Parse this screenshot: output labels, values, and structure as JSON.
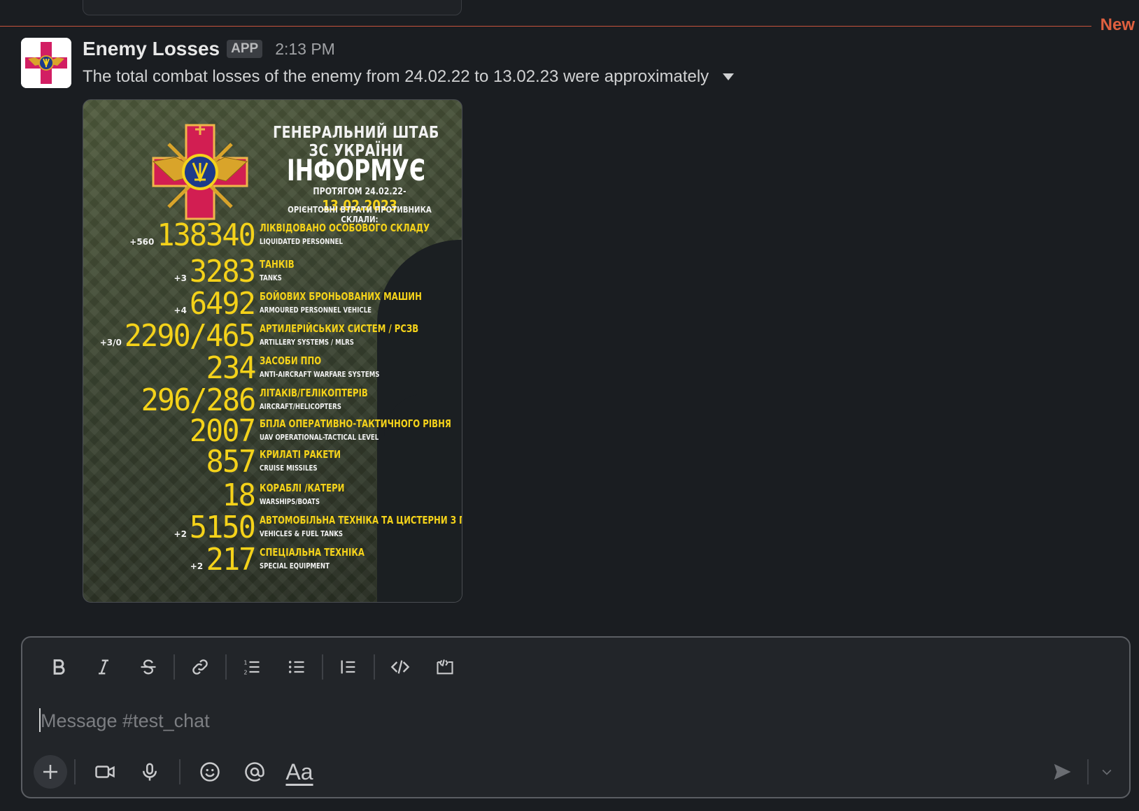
{
  "divider": {
    "label": "New"
  },
  "message": {
    "sender": "Enemy Losses",
    "badge": "APP",
    "time": "2:13 PM",
    "text": "The total combat losses of the enemy from 24.02.22 to 13.02.23 were approximately"
  },
  "poster": {
    "title": "ГЕНЕРАЛЬНИЙ ШТАБ ЗС УКРАЇНИ",
    "subtitle": "ІНФОРМУЄ",
    "period_prefix": "ПРОТЯГОМ 24.02.22-",
    "period_date": "13.02.2023",
    "caption": "ОРІЄНТОВНІ ВТРАТИ ПРОТИВНИКА СКЛАЛИ:",
    "stats": [
      {
        "delta": "+560",
        "value": "138340",
        "ua": "ЛІКВІДОВАНО ОСОБОВОГО СКЛАДУ",
        "en": "LIQUIDATED PERSONNEL"
      },
      {
        "delta": "+3",
        "value": "3283",
        "ua": "ТАНКІВ",
        "en": "TANKS"
      },
      {
        "delta": "+4",
        "value": "6492",
        "ua": "БОЙОВИХ БРОНЬОВАНИХ МАШИН",
        "en": "ARMOURED PERSONNEL VEHICLE"
      },
      {
        "delta": "+3/0",
        "value": "2290/465",
        "ua": "АРТИЛЕРІЙСЬКИХ СИСТЕМ / РСЗВ",
        "en": "ARTILLERY SYSTEMS / MLRS"
      },
      {
        "delta": "",
        "value": "234",
        "ua": "ЗАСОБИ ППО",
        "en": "ANTI-AIRCRAFT WARFARE SYSTEMS"
      },
      {
        "delta": "",
        "value": "296/286",
        "ua": "ЛІТАКІВ/ГЕЛІКОПТЕРІВ",
        "en": "AIRCRAFT/HELICOPTERS"
      },
      {
        "delta": "",
        "value": "2007",
        "ua": "БПЛА ОПЕРАТИВНО-ТАКТИЧНОГО РІВНЯ",
        "en": "UAV OPERATIONAL-TACTICAL LEVEL"
      },
      {
        "delta": "",
        "value": "857",
        "ua": "КРИЛАТІ РАКЕТИ",
        "en": "CRUISE MISSILES"
      },
      {
        "delta": "",
        "value": "18",
        "ua": "КОРАБЛІ /КАТЕРИ",
        "en": "WARSHIPS/BOATS"
      },
      {
        "delta": "+2",
        "value": "5150",
        "ua": "АВТОМОБІЛЬНА ТЕХНІКА ТА ЦИСТЕРНИ З ПММ",
        "en": "VEHICLES & FUEL TANKS"
      },
      {
        "delta": "+2",
        "value": "217",
        "ua": "СПЕЦІАЛЬНА ТЕХНІКА",
        "en": "SPECIAL EQUIPMENT"
      }
    ]
  },
  "composer": {
    "placeholder": "Message #test_chat",
    "toolbar_icons": [
      "bold-icon",
      "italic-icon",
      "strikethrough-icon",
      "link-icon",
      "ordered-list-icon",
      "bulleted-list-icon",
      "blockquote-icon",
      "code-icon",
      "code-block-icon"
    ],
    "bottom_icons": [
      "plus-icon",
      "video-icon",
      "microphone-icon",
      "emoji-icon",
      "mention-icon",
      "formatting-icon"
    ],
    "format_label": "Aa"
  },
  "colors": {
    "accent_new": "#e0603f",
    "poster_yellow": "#f4d21a",
    "background": "#1a1d21"
  }
}
